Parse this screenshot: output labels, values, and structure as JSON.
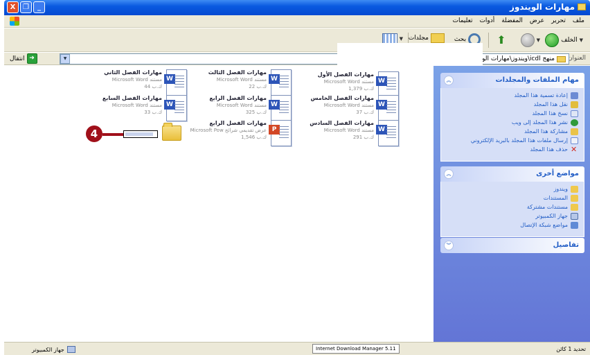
{
  "window": {
    "title": "مهارات الويندوز",
    "controls": [
      "X",
      "❐",
      "_"
    ]
  },
  "menu": [
    "ملف",
    "تحرير",
    "عرض",
    "المفضلة",
    "أدوات",
    "تعليمات"
  ],
  "toolbar": {
    "back": "الخلف",
    "search": "بحث",
    "folders": "مجلدات"
  },
  "address": {
    "label": "العنوان",
    "path": "C:\\ويندوز\\مهارات الويندوز\\icdl منهج",
    "go": "انتقال"
  },
  "tasks_panel": {
    "title": "مهام الملفات والمجلدات",
    "items": [
      "إعادة تسمية هذا المجلد",
      "نقل هذا المجلد",
      "نسخ هذا المجلد",
      "نشر هذا المجلد إلى ويب",
      "مشاركة هذا المجلد",
      "إرسال ملفات هذا المجلد بالبريد الإلكتروني",
      "حذف هذا المجلد"
    ]
  },
  "places_panel": {
    "title": "مواضع أخرى",
    "items": [
      "ويندوز",
      "المستندات",
      "مستندات مشتركة",
      "جهاز الكمبيوتر",
      "مواضع شبكة الإتصال"
    ]
  },
  "details_panel": {
    "title": "تفاصيل"
  },
  "files": [
    {
      "name": "مهارات الفصل الأول",
      "type": "Microsoft Word مستند",
      "size": "1,379 ك.ب"
    },
    {
      "name": "مهارات الفصل الثالث",
      "type": "Microsoft Word مستند",
      "size": "22 ك.ب"
    },
    {
      "name": "مهارات الفصل الثاني",
      "type": "Microsoft Word مستند",
      "size": "44 ك.ب"
    },
    {
      "name": "مهارات الفصل الخامس",
      "type": "Microsoft Word مستند",
      "size": "37 ك.ب"
    },
    {
      "name": "مهارات الفصل الرابع",
      "type": "Microsoft Word مستند",
      "size": "325 ك.ب"
    },
    {
      "name": "مهارات الفصل السابع",
      "type": "Microsoft Word مستند",
      "size": "33 ك.ب"
    },
    {
      "name": "مهارات الفصل السادس",
      "type": "Microsoft Word مستند",
      "size": "291 ك.ب"
    },
    {
      "name": "مهارات الفصل الرابع",
      "type": "Microsoft Pow عرض تقديمي شرائح",
      "size": "1,546 ك.ب"
    }
  ],
  "callout": "4",
  "status": {
    "left": "جهاز الكمبيوتر",
    "middle": "Internet Download Manager 5.11",
    "right": "تحديد 1 كائن"
  }
}
